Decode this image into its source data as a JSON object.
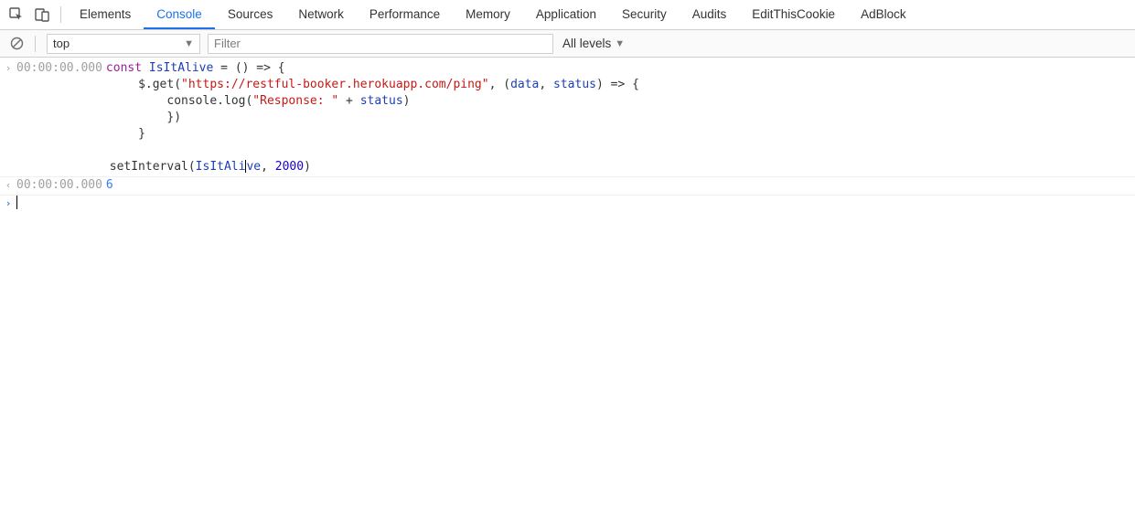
{
  "tabs": [
    "Elements",
    "Console",
    "Sources",
    "Network",
    "Performance",
    "Memory",
    "Application",
    "Security",
    "Audits",
    "EditThisCookie",
    "AdBlock"
  ],
  "activeTab": "Console",
  "toolbar": {
    "context": "top",
    "filter_placeholder": "Filter",
    "levels": "All levels"
  },
  "log": {
    "input": {
      "timestamp": "00:00:00.000",
      "lines": [
        {
          "segments": [
            {
              "t": "const ",
              "c": "k-const"
            },
            {
              "t": "IsItAlive",
              "c": "k-ident"
            },
            {
              "t": " = () => {",
              "c": ""
            }
          ]
        },
        {
          "indent": 4,
          "segments": [
            {
              "t": "$.get(",
              "c": ""
            },
            {
              "t": "\"https://restful-booker.herokuapp.com/ping\"",
              "c": "k-str"
            },
            {
              "t": ", (",
              "c": ""
            },
            {
              "t": "data",
              "c": "k-ident"
            },
            {
              "t": ", ",
              "c": ""
            },
            {
              "t": "status",
              "c": "k-ident"
            },
            {
              "t": ") => {",
              "c": ""
            }
          ]
        },
        {
          "indent": 8,
          "segments": [
            {
              "t": "console.log(",
              "c": ""
            },
            {
              "t": "\"Response: \"",
              "c": "k-str"
            },
            {
              "t": " + ",
              "c": ""
            },
            {
              "t": "status",
              "c": "k-ident"
            },
            {
              "t": ")",
              "c": ""
            }
          ]
        },
        {
          "indent": 8,
          "segments": [
            {
              "t": "})",
              "c": ""
            }
          ]
        },
        {
          "indent": 4,
          "segments": [
            {
              "t": "}",
              "c": ""
            }
          ]
        },
        {
          "indent": 0,
          "segments": [
            {
              "t": "",
              "c": ""
            }
          ]
        },
        {
          "indent": 0,
          "segments": [
            {
              "t": "setInterval(",
              "c": ""
            },
            {
              "t": "IsItAl",
              "c": "k-ident"
            },
            {
              "t": "i",
              "c": "k-ident",
              "caret": true
            },
            {
              "t": "ve",
              "c": "k-ident"
            },
            {
              "t": ", ",
              "c": ""
            },
            {
              "t": "2000",
              "c": "k-num"
            },
            {
              "t": ")",
              "c": ""
            }
          ]
        }
      ]
    },
    "output": {
      "timestamp": "00:00:00.000",
      "value": "6"
    }
  }
}
